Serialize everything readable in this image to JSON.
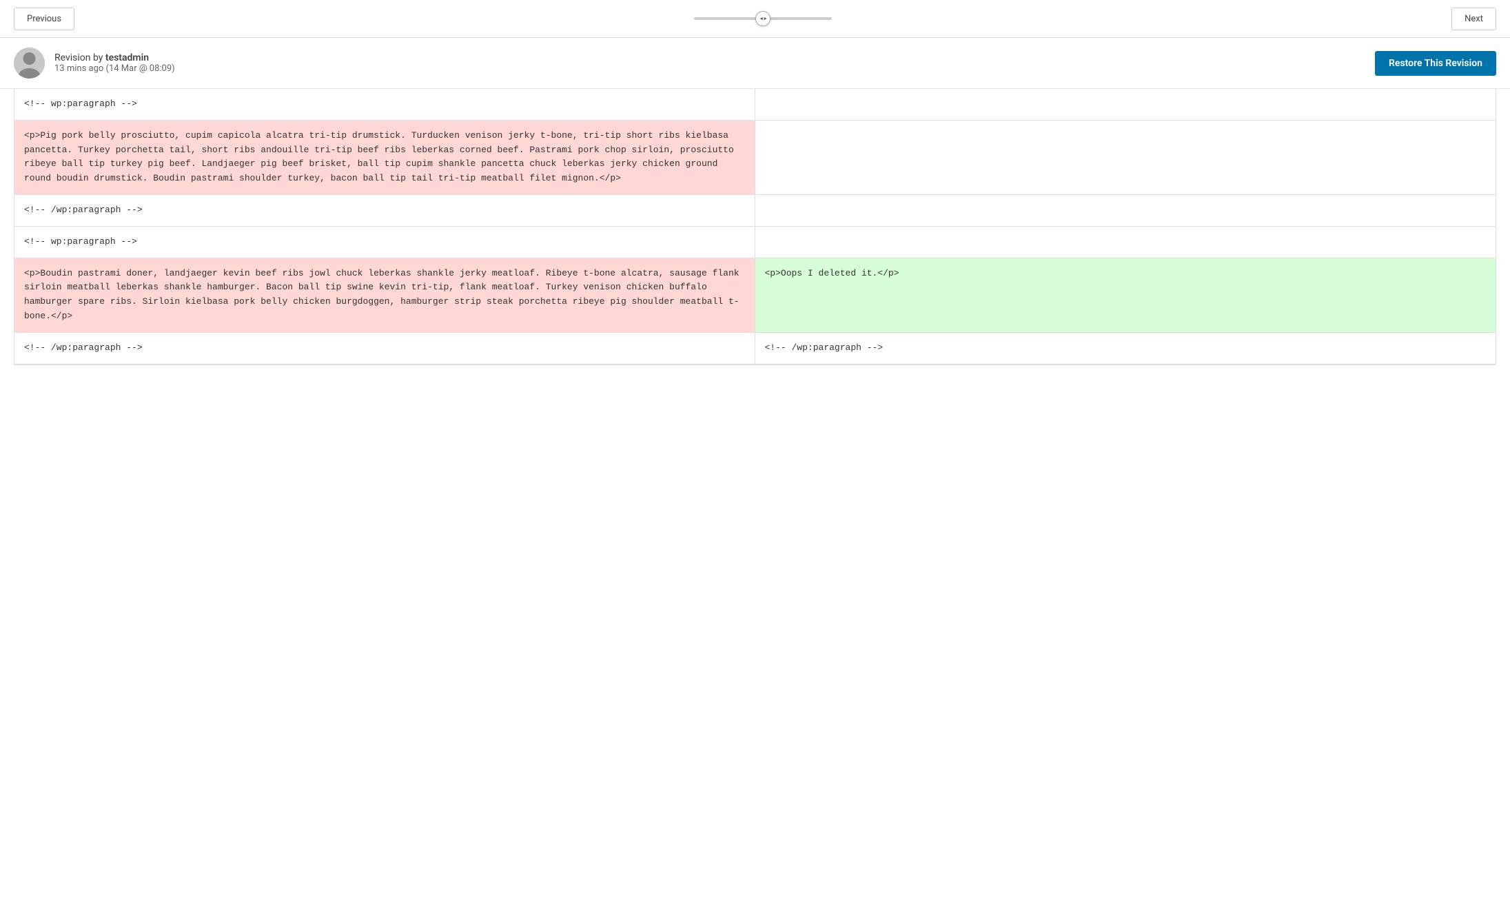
{
  "nav": {
    "previous_label": "Previous",
    "next_label": "Next"
  },
  "revision": {
    "by_label": "Revision by",
    "author": "testadmin",
    "time": "13 mins ago (14 Mar @ 08:09)",
    "restore_label": "Restore This Revision"
  },
  "diff": {
    "rows": [
      {
        "left_class": "neutral",
        "right_class": "empty",
        "left_text": "<!-- wp:paragraph -->",
        "right_text": ""
      },
      {
        "left_class": "removed",
        "right_class": "empty",
        "left_text": "<p>Pig pork belly prosciutto, cupim capicola alcatra tri-tip drumstick. Turducken venison jerky t-bone, tri-tip short ribs kielbasa pancetta. Turkey porchetta tail, short ribs andouille tri-tip beef ribs leberkas corned beef. Pastrami pork chop sirloin, prosciutto ribeye ball tip turkey pig beef. Landjaeger pig beef brisket, ball tip cupim shankle pancetta chuck leberkas jerky chicken ground round boudin drumstick. Boudin pastrami shoulder turkey, bacon ball tip tail tri-tip meatball filet mignon.</p>",
        "right_text": ""
      },
      {
        "left_class": "neutral",
        "right_class": "empty",
        "left_text": "<!-- /wp:paragraph -->",
        "right_text": ""
      },
      {
        "left_class": "neutral",
        "right_class": "empty",
        "left_text": "<!-- wp:paragraph -->",
        "right_text": ""
      },
      {
        "left_class": "removed",
        "right_class": "added",
        "left_text": "<p>Boudin pastrami doner, landjaeger kevin beef ribs jowl chuck leberkas shankle jerky meatloaf. Ribeye t-bone alcatra, sausage flank sirloin meatball leberkas shankle hamburger. Bacon ball tip swine kevin tri-tip, flank meatloaf. Turkey venison chicken buffalo hamburger spare ribs. Sirloin kielbasa pork belly chicken burgdoggen, hamburger strip steak porchetta ribeye pig shoulder meatball t-bone.</p>",
        "right_text": "<p>Oops I deleted it.</p>"
      },
      {
        "left_class": "neutral",
        "right_class": "neutral",
        "left_text": "<!-- /wp:paragraph -->",
        "right_text": "<!-- /wp:paragraph -->"
      }
    ]
  }
}
